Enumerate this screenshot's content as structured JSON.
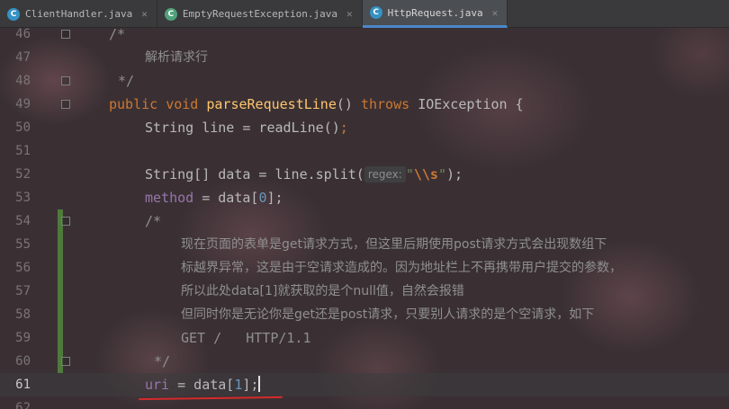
{
  "tabs": [
    {
      "label": "ClientHandler.java",
      "icon": "class-icon",
      "active": false
    },
    {
      "label": "EmptyRequestException.java",
      "icon": "exception-class-icon",
      "active": false
    },
    {
      "label": "HttpRequest.java",
      "icon": "class-icon",
      "active": true
    }
  ],
  "line_numbers": [
    "46",
    "47",
    "48",
    "49",
    "50",
    "51",
    "52",
    "53",
    "54",
    "55",
    "56",
    "57",
    "58",
    "59",
    "60",
    "61",
    "62"
  ],
  "code": {
    "l46": "/*",
    "l47": "解析请求行",
    "l48": "*/",
    "l49": {
      "kw1": "public",
      "kw2": "void",
      "fn": "parseRequestLine",
      "p": "()",
      "kw3": "throws",
      "t": "IOException {"
    },
    "l50": {
      "a": "String line = readLine()",
      "semi": ";"
    },
    "l52": {
      "a": "String[] data = line.split(",
      "hint": "regex:",
      "q1": "\"",
      "esc": "\\\\s",
      "q2": "\"",
      "b": ");"
    },
    "l53": {
      "field": "method",
      "a": " = data[",
      "num": "0",
      "b": "];"
    },
    "l54": "/*",
    "l55": "现在页面的表单是get请求方式，但这里后期使用post请求方式会出现数组下",
    "l56": "标越界异常，这是由于空请求造成的。因为地址栏上不再携带用户提交的参数，",
    "l57": "所以此处data[1]就获取的是个null值，自然会报错",
    "l58": "但同时你是无论你是get还是post请求，只要别人请求的是个空请求，如下",
    "l59": "GET /   HTTP/1.1",
    "l60": "*/",
    "l61": {
      "field": "uri",
      "a": " = data[",
      "num": "1",
      "b": "];"
    }
  }
}
